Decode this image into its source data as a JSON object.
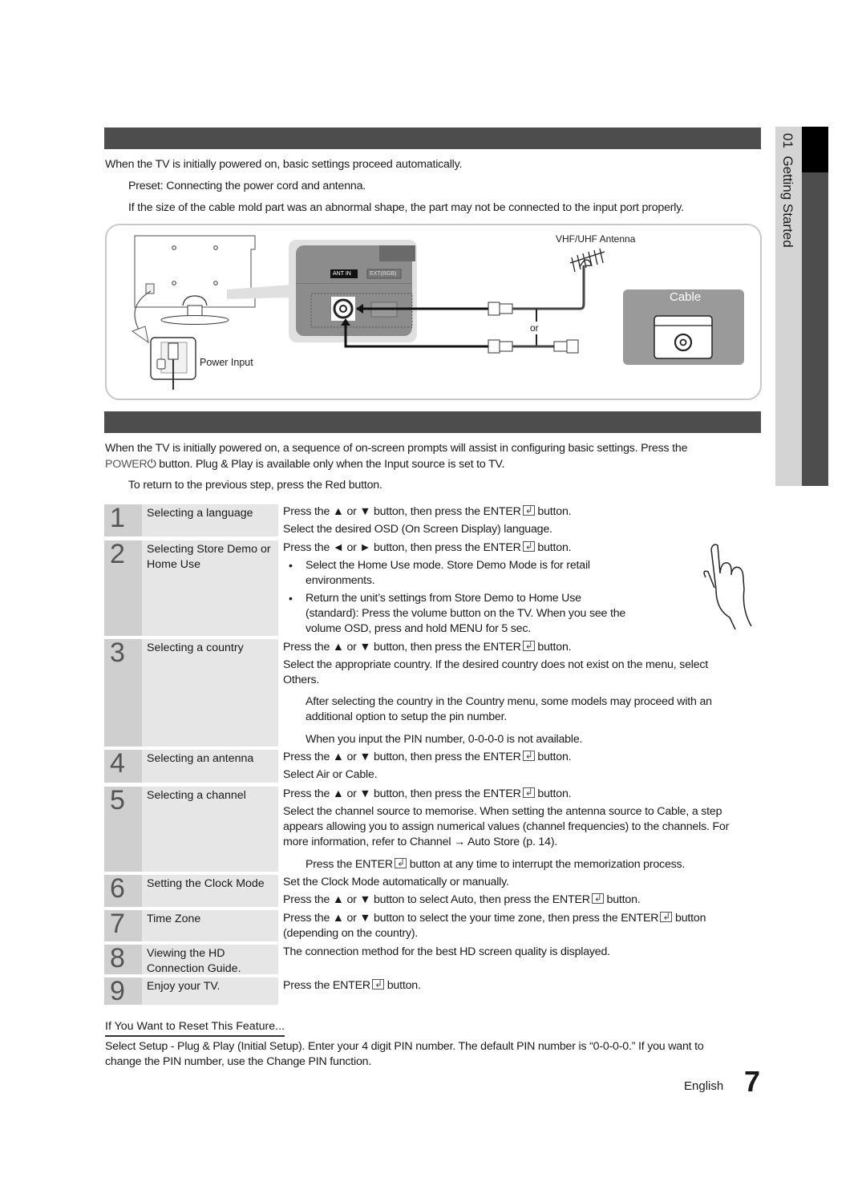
{
  "side_tab": {
    "chapter": "01",
    "title": "Getting Started"
  },
  "section1": {
    "intro": "When the TV is initially powered on, basic settings proceed automatically.",
    "note1": "Preset: Connecting the power cord and antenna.",
    "note2": "If the size of the cable mold part was an abnormal shape, the part may not be connected to the input port properly."
  },
  "diagram": {
    "power_input_label": "Power Input",
    "ant_in_label": "ANT IN",
    "ext_label": "EXT(RGB)",
    "antenna_label": "VHF/UHF Antenna",
    "or_label": "or",
    "cable_label": "Cable",
    "colors": {
      "panel": "#8c8c8c",
      "cable_box": "#9a9a9a",
      "frame": "#c8c8c8"
    }
  },
  "section2": {
    "intro_line1": "When the TV is initially powered on, a sequence of on-screen prompts will assist in configuring basic settings. Press the",
    "power_kw": "POWER",
    "intro_line2_a": " button. ",
    "plug_play": "Plug & Play",
    "intro_line2_b": " is available only when the ",
    "input_kw": "Input",
    "intro_line2_c": " source is set to TV.",
    "note": "To return to the previous step, press the Red button."
  },
  "steps": [
    {
      "num": "1",
      "title": "Selecting a language",
      "lines": [
        "Press the ▲ or ▼ button, then press the ENTER",
        "Select the desired OSD (On Screen Display) language."
      ]
    },
    {
      "num": "2",
      "title": "Selecting Store Demo or Home Use",
      "lines": [
        "Press the ◄ or ► button, then press the ENTER",
        "Select the Home Use mode. Store Demo Mode is for retail",
        "environments.",
        "Return the unit’s settings from Store Demo to Home Use",
        "(standard): Press the volume button on the TV. When you see the",
        "volume OSD, press and hold MENU for 5 sec."
      ]
    },
    {
      "num": "3",
      "title": "Selecting a country",
      "lines": [
        "Press the ▲ or ▼ button, then press the ENTER",
        "Select the appropriate country. If the desired country does not exist on the menu, select",
        "Others.",
        "After selecting the country in the Country menu, some models may proceed with an",
        "additional option to setup the pin number.",
        "When you input the PIN number, 0-0-0-0 is not available."
      ]
    },
    {
      "num": "4",
      "title": "Selecting an antenna",
      "lines": [
        "Press the ▲ or ▼ button, then press the ENTER",
        "Select Air or Cable."
      ]
    },
    {
      "num": "5",
      "title": "Selecting a channel",
      "lines": [
        "Press the ▲ or ▼ button, then press the ENTER",
        "Select the channel source to memorise. When setting the antenna source to Cable, a step",
        "appears allowing you to assign numerical values (channel frequencies) to the channels. For",
        "more information, refer to Channel → Auto Store (p. 14).",
        "Press the ENTER",
        " button at any time to interrupt the memorization process."
      ]
    },
    {
      "num": "6",
      "title": "Setting the Clock Mode",
      "lines": [
        "Set the Clock Mode automatically or manually.",
        "Press the ▲ or ▼ button to select Auto, then press the ENTER"
      ]
    },
    {
      "num": "7",
      "title": "Time Zone",
      "lines": [
        "Press the ▲ or ▼ button to select the your time zone, then press the ENTER",
        "(depending on the country)."
      ]
    },
    {
      "num": "8",
      "title": "Viewing the HD Connection Guide.",
      "lines": [
        "The connection method for the best HD screen quality is displayed."
      ]
    },
    {
      "num": "9",
      "title": "Enjoy your TV.",
      "lines": [
        "Press the ENTER"
      ]
    }
  ],
  "button_suffix": " button.",
  "button_suffix_plain": " button",
  "reset": {
    "heading": "If You Want to Reset This Feature...",
    "line1": "Select Setup - Plug & Play (Initial Setup). Enter your 4 digit PIN number. The default PIN number is “0-0-0-0.” If you want to",
    "line2": "change the PIN number, use the Change PIN function."
  },
  "footer": {
    "language": "English",
    "page": "7"
  }
}
